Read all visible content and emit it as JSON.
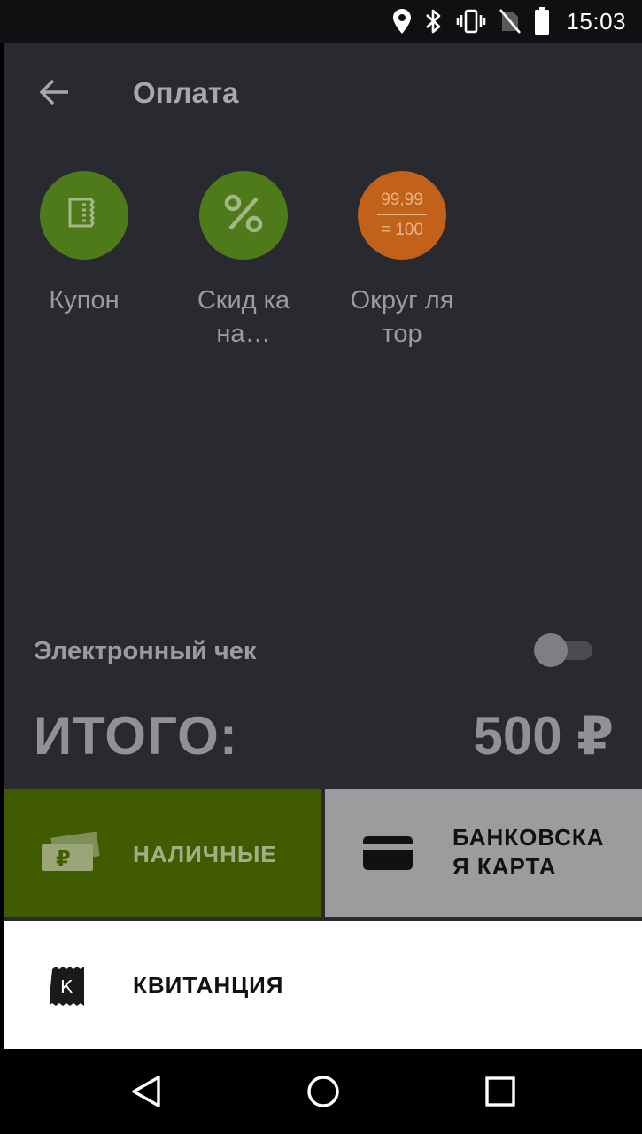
{
  "status_bar": {
    "time": "15:03",
    "icons": [
      "location-icon",
      "bluetooth-icon",
      "vibrate-icon",
      "no-sim-icon",
      "battery-icon"
    ]
  },
  "header": {
    "title": "Оплата",
    "back_icon": "arrow-left-icon"
  },
  "actions": [
    {
      "label": "Купон",
      "color": "#4f7a1a",
      "icon": "coupon-icon"
    },
    {
      "label": "Скид ка на…",
      "color": "#4f7a1a",
      "icon": "percent-icon"
    },
    {
      "label": "Округ лятор",
      "color": "#c2621a",
      "icon": "rounder-icon",
      "icon_top": "99,99",
      "icon_bottom": "= 100"
    }
  ],
  "ereceipt": {
    "label": "Электронный чек",
    "enabled": false
  },
  "total": {
    "label": "ИТОГО:",
    "value": "500 ₽"
  },
  "payment": {
    "cash_label": "НАЛИЧНЫЕ",
    "card_label": "БАНКОВСКА Я КАРТА",
    "receipt_label": "КВИТАНЦИЯ",
    "receipt_icon_letter": "К"
  },
  "colors": {
    "background": "#292930",
    "cash": "#415c00",
    "card": "#9c9c9e",
    "receipt": "#ffffff",
    "action_green": "#4f7a1a",
    "action_orange": "#c2621a"
  }
}
